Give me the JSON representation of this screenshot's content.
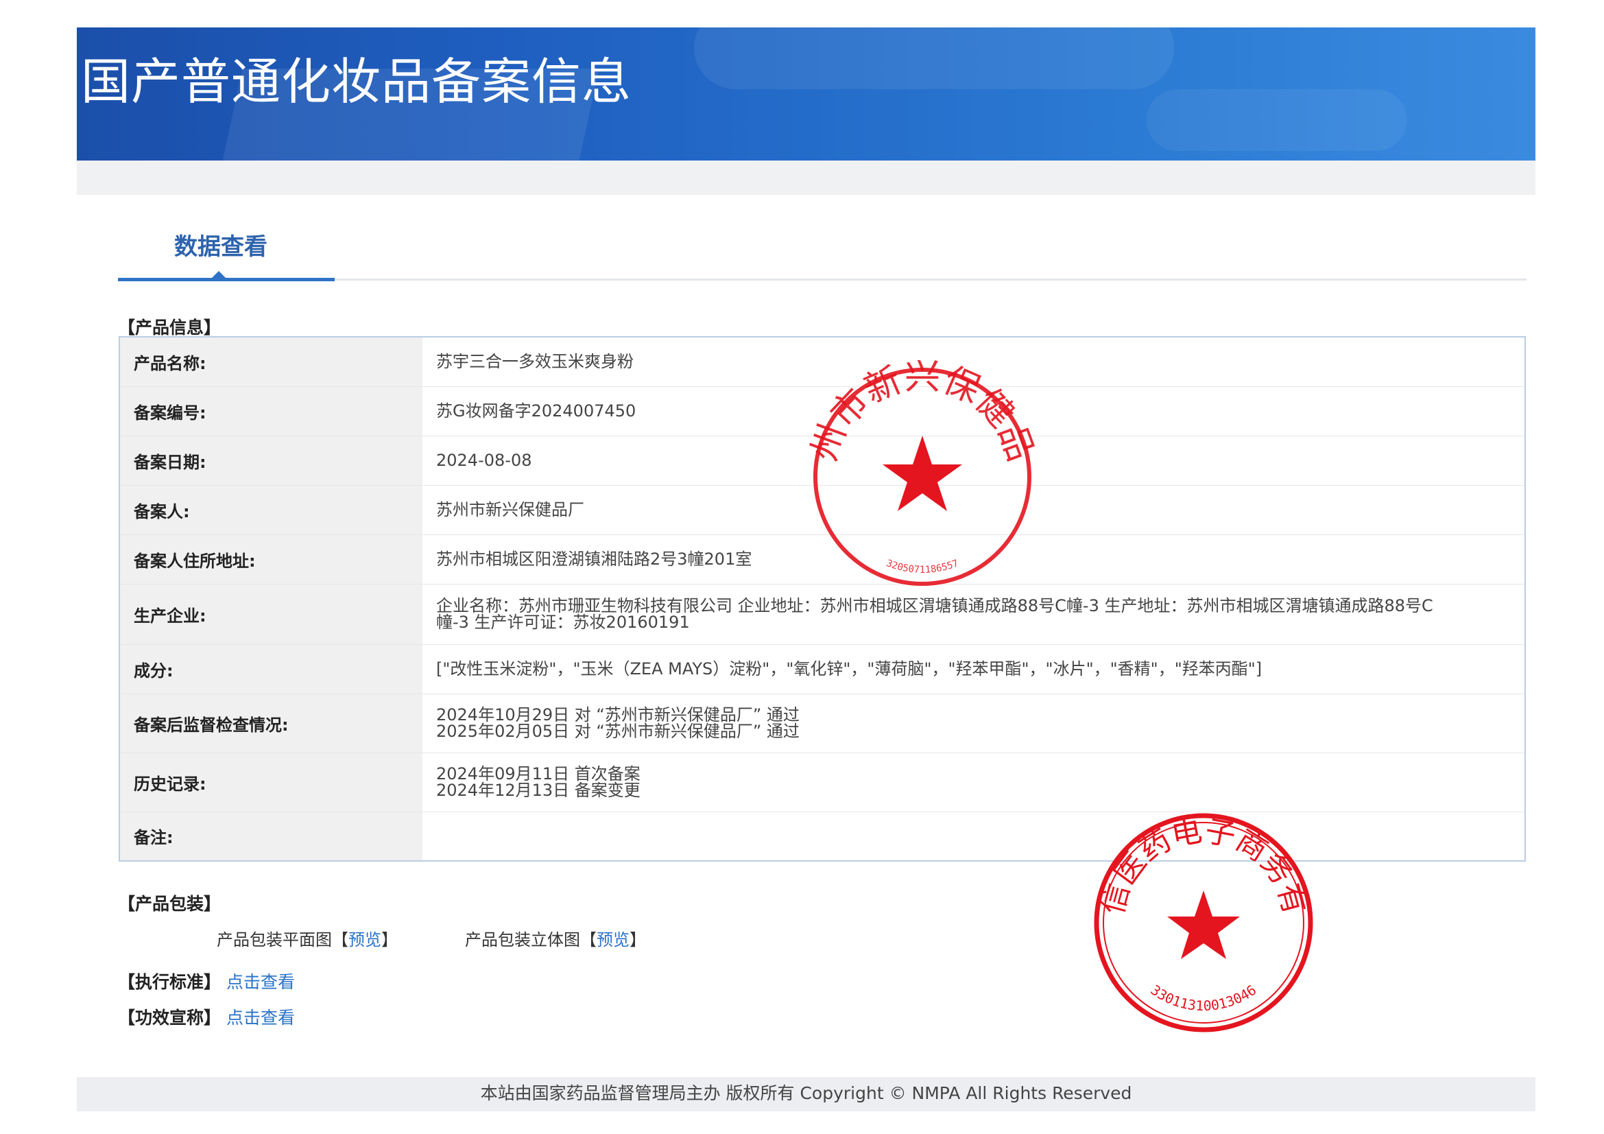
{
  "banner": {
    "title": "国产普通化妆品备案信息"
  },
  "tab": {
    "label": "数据查看"
  },
  "sections": {
    "product_info": "【产品信息】",
    "product_package": "【产品包装】",
    "standard": "【执行标准】",
    "efficacy": "【功效宣称】"
  },
  "product_info": [
    {
      "key": "产品名称:",
      "value": "苏宇三合一多效玉米爽身粉"
    },
    {
      "key": "备案编号:",
      "value": "苏G妆网备字2024007450"
    },
    {
      "key": "备案日期:",
      "value": "2024-08-08"
    },
    {
      "key": "备案人:",
      "value": "苏州市新兴保健品厂"
    },
    {
      "key": "备案人住所地址:",
      "value": "苏州市相城区阳澄湖镇湘陆路2号3幢201室"
    },
    {
      "key": "生产企业:",
      "value": "企业名称：苏州市珊亚生物科技有限公司 企业地址：苏州市相城区渭塘镇通成路88号C幢-3 生产地址：苏州市相城区渭塘镇通成路88号C幢-3 生产许可证：苏妆20160191"
    },
    {
      "key": "成分:",
      "value": "[\"改性玉米淀粉\"，\"玉米（ZEA MAYS）淀粉\"，\"氧化锌\"，\"薄荷脑\"，\"羟苯甲酯\"，\"冰片\"，\"香精\"，\"羟苯丙酯\"]"
    },
    {
      "key": "备案后监督检查情况:",
      "lines": [
        "2024年10月29日 对 “苏州市新兴保健品厂” 通过",
        "2025年02月05日 对 “苏州市新兴保健品厂” 通过"
      ]
    },
    {
      "key": "历史记录:",
      "lines": [
        "2024年09月11日 首次备案",
        "2024年12月13日 备案变更"
      ]
    },
    {
      "key": "备注:",
      "value": ""
    }
  ],
  "package": {
    "flat_label": "产品包装平面图",
    "solid_label": "产品包装立体图",
    "bracket_open": "【",
    "bracket_close": "】",
    "preview": "预览"
  },
  "links": {
    "view": "点击查看"
  },
  "footer": {
    "text": "本站由国家药品监督管理局主办 版权所有 Copyright © NMPA All Rights Reserved"
  },
  "stamps": {
    "stamp1": {
      "ring": "苏州市新兴保健品厂",
      "code": "3205071186557"
    },
    "stamp2": {
      "ring": "苏州凯信医药电子商务有限公司",
      "code": "33011310013046"
    }
  },
  "colors": {
    "banner_blue": "#1f5fc0",
    "link_blue": "#2a72c9",
    "stamp_red": "#e4151f"
  }
}
